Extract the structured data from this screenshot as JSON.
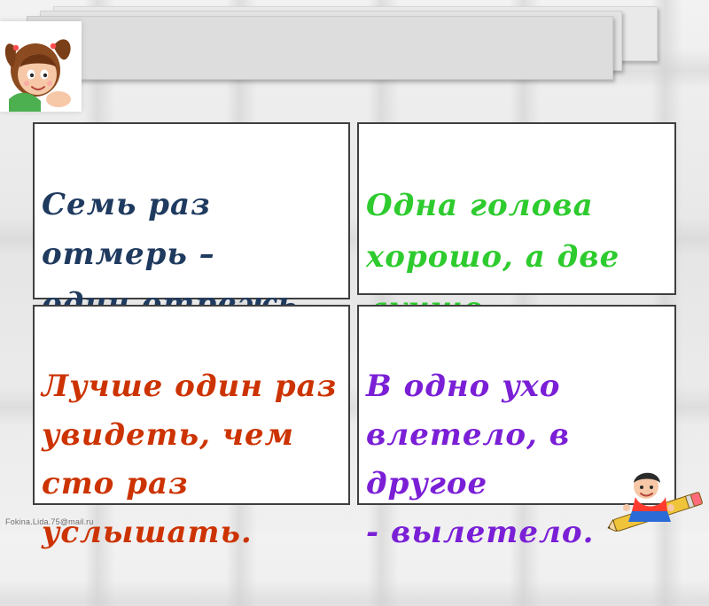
{
  "slide": {
    "cards": [
      {
        "text": "Семь раз\nотмерь –\nодин отрежь.",
        "color": "#1f3a5f"
      },
      {
        "text": "Одна голова\nхорошо, а две\nлучше.",
        "color": "#2ecb2e"
      },
      {
        "text": "Лучше один раз\nувидеть, чем\nсто раз\nуслышать.",
        "color": "#cc3300"
      },
      {
        "text": "В одно ухо\nвлетело, в другое\n- вылетело.",
        "color": "#7a1fd6"
      }
    ],
    "decorations": {
      "top_left": "girl-with-pigtails-icon",
      "bottom_right": "boy-on-pencil-icon"
    },
    "footer_email": "Fokina.Lida.75@mail.ru"
  }
}
